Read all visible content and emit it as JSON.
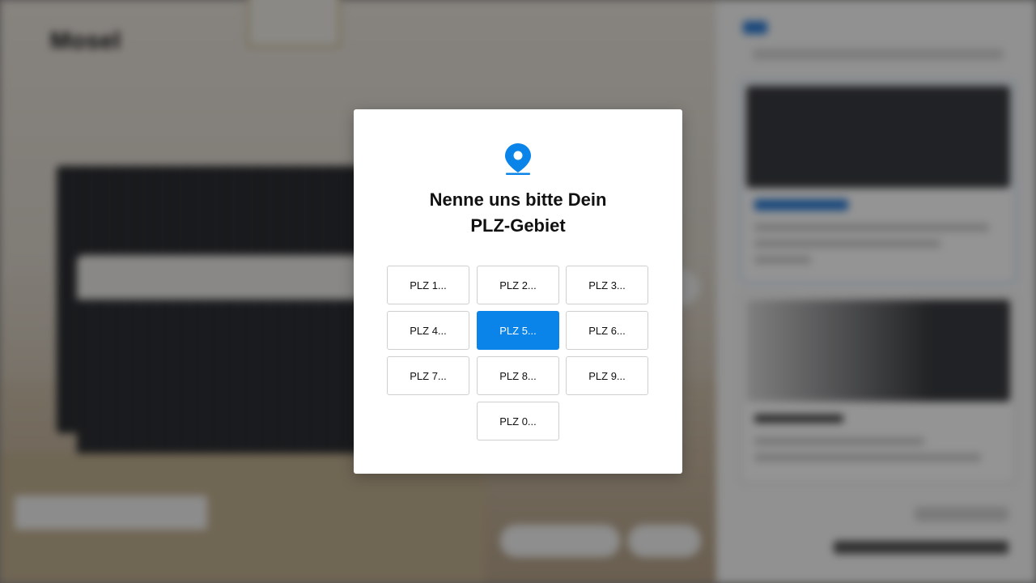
{
  "background": {
    "brand": "Mosel"
  },
  "modal": {
    "icon": "location-pin-icon",
    "title_line1": "Nenne uns bitte Dein",
    "title_line2": "PLZ-Gebiet",
    "accent_color": "#0a84e8",
    "options": [
      {
        "label": "PLZ 1..."
      },
      {
        "label": "PLZ 2..."
      },
      {
        "label": "PLZ 3..."
      },
      {
        "label": "PLZ 4..."
      },
      {
        "label": "PLZ 5...",
        "selected": true
      },
      {
        "label": "PLZ 6..."
      },
      {
        "label": "PLZ 7..."
      },
      {
        "label": "PLZ 8..."
      },
      {
        "label": "PLZ 9..."
      },
      {
        "label": "PLZ 0..."
      }
    ]
  }
}
